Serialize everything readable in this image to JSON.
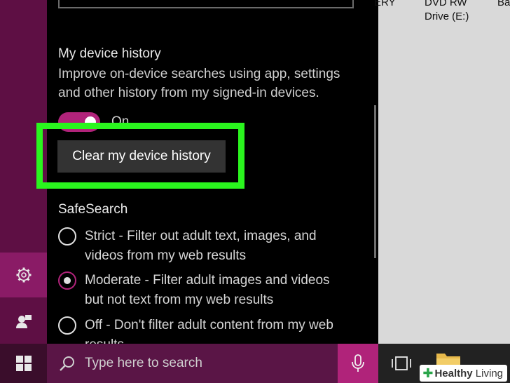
{
  "panel": {
    "device_history": {
      "title": "My device history",
      "description_line1": "Improve on-device searches using app, settings",
      "description_line2": "and other history from my signed-in devices.",
      "toggle_state": "On",
      "clear_button": "Clear my device history"
    },
    "safesearch": {
      "title": "SafeSearch",
      "options": [
        {
          "line1": "Strict - Filter out adult text, images, and",
          "line2": "videos from my web results",
          "selected": false
        },
        {
          "line1": "Moderate - Filter adult images and videos",
          "line2": "but not text from my web results",
          "selected": true
        },
        {
          "line1": "Off - Don't filter adult content from my web",
          "line2": "results",
          "selected": false
        }
      ]
    }
  },
  "desktop": {
    "drive1_label": "ERY",
    "drive2_line1": "DVD RW",
    "drive2_line2": "Drive (E:)",
    "drive3_label": "Ba"
  },
  "taskbar": {
    "search_placeholder": "Type here to search"
  },
  "watermark": {
    "bold": "Healthy",
    "light": " Living"
  },
  "colors": {
    "accent": "#b0237a",
    "sidebar": "#5e0f44",
    "highlight": "#2af51e"
  },
  "icons": [
    "settings-gear-icon",
    "feedback-person-icon",
    "windows-logo-icon",
    "search-icon",
    "microphone-icon",
    "task-view-icon",
    "folder-icon"
  ]
}
